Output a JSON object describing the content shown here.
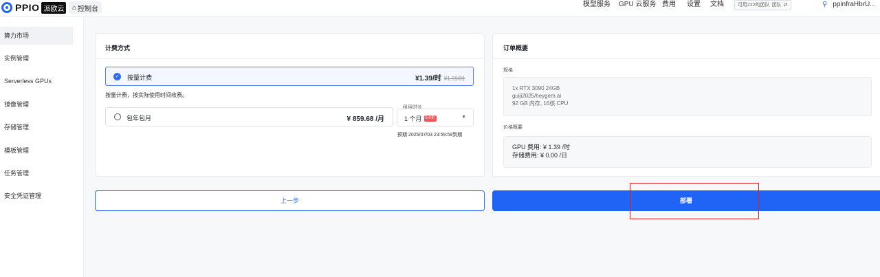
{
  "topbar": {
    "brand": "PPIO",
    "brand_badge": "派欧云",
    "console": "控制台",
    "nav": [
      "模型服务",
      "GPU 云服务",
      "费用",
      "设置",
      "文档"
    ],
    "team_text": "可用222的团队",
    "team_label": "团队",
    "team_switch": "⇄",
    "user": "ppinfraHbrU..."
  },
  "sidebar": {
    "items": [
      "算力市场",
      "实例管理",
      "Serverless GPUs",
      "镜像管理",
      "存储管理",
      "模板管理",
      "任务管理",
      "安全凭证管理"
    ],
    "active_index": 0
  },
  "billing": {
    "title": "计费方式",
    "option1_label": "按量计费",
    "option1_price": "¥1.39/时",
    "option1_old_price": "¥1.99/时",
    "option1_desc": "按量计费，按实际使用时间收费。",
    "option2_label": "包年包月",
    "option2_price": "¥ 859.68 /月",
    "duration_label": "租用时长",
    "duration_value": "1 个月",
    "duration_discount": "6.0折",
    "expire_text": "预期 2025/07/03 23:59:59到期"
  },
  "summary": {
    "title": "订单概要",
    "spec_label": "规格",
    "spec_lines": [
      "1x RTX 3090 24GB",
      "guiji2025/heygem.ai",
      "92 GB 内存, 16核 CPU"
    ],
    "price_label": "价格概要",
    "gpu_fee": "GPU 费用:  ¥ 1.39 /时",
    "storage_fee": "存储费用:  ¥ 0.00 /日"
  },
  "actions": {
    "prev": "上一步",
    "deploy": "部署"
  },
  "colors": {
    "accent": "#1f64f5",
    "highlight": "#e0201f",
    "discount": "#f05454"
  }
}
